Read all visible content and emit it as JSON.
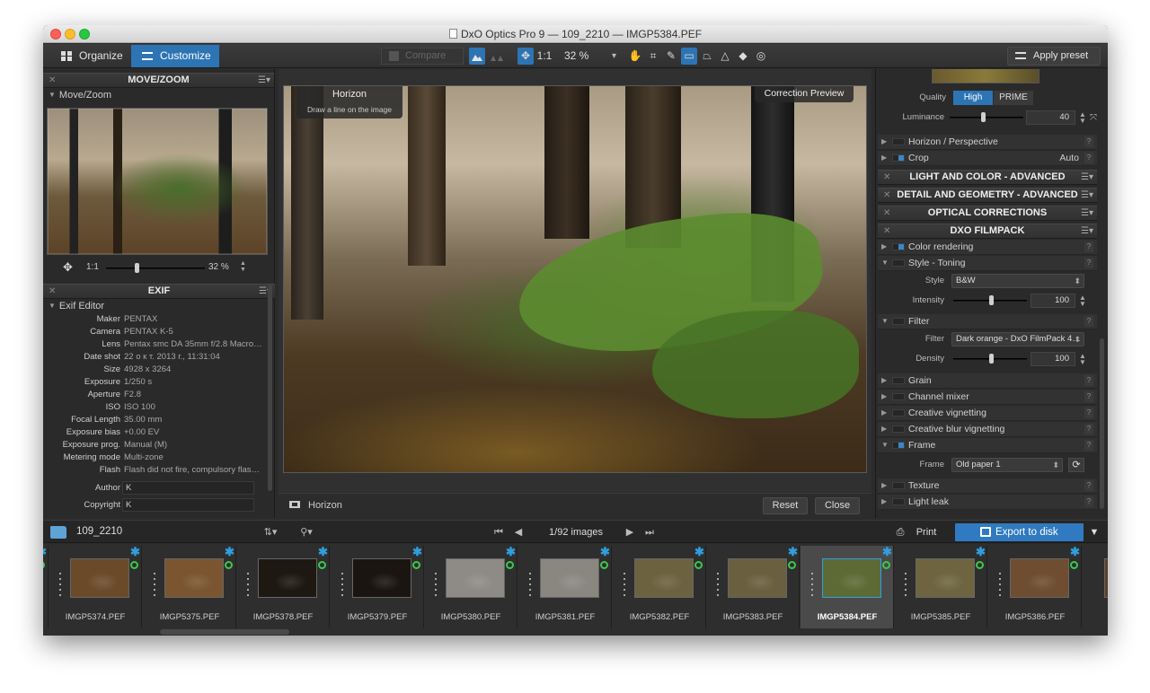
{
  "window": {
    "title": "DxO Optics Pro 9 — 109_2210 — IMGP5384.PEF"
  },
  "toolbar": {
    "tab_organize": "Organize",
    "tab_customize": "Customize",
    "compare_label": "Compare",
    "one_to_one": "1:1",
    "zoom_value": "32 %",
    "apply_preset": "Apply preset"
  },
  "left": {
    "movezoom_header": "MOVE/ZOOM",
    "movezoom_sub": "Move/Zoom",
    "nav_one_to_one": "1:1",
    "nav_zoom": "32 %",
    "nav_zoom_level": 0.32,
    "exif_header": "EXIF",
    "exif_sub": "Exif Editor",
    "exif_rows": [
      {
        "k": "Maker",
        "v": "PENTAX"
      },
      {
        "k": "Camera",
        "v": "PENTAX K-5"
      },
      {
        "k": "Lens",
        "v": "Pentax smc DA 35mm f/2.8 Macro…"
      },
      {
        "k": "Date shot",
        "v": "22 о к т. 2013 г., 11:31:04"
      },
      {
        "k": "Size",
        "v": "4928 x 3264"
      },
      {
        "k": "Exposure",
        "v": "1/250 s"
      },
      {
        "k": "Aperture",
        "v": "F2.8"
      },
      {
        "k": "ISO",
        "v": "ISO 100"
      },
      {
        "k": "Focal Length",
        "v": "35.00 mm"
      },
      {
        "k": "Exposure bias",
        "v": "+0.00 EV"
      },
      {
        "k": "Exposure prog.",
        "v": "Manual (M)"
      },
      {
        "k": "Metering mode",
        "v": "Multi-zone"
      },
      {
        "k": "Flash",
        "v": "Flash did not fire, compulsory flash…"
      }
    ],
    "author_label": "Author",
    "author_value": "K",
    "copyright_label": "Copyright",
    "copyright_value": "K"
  },
  "center": {
    "horizon_title": "Horizon",
    "horizon_hint": "Draw a line on the image",
    "correction_preview": "Correction Preview",
    "bottom_label": "Horizon",
    "reset": "Reset",
    "close": "Close"
  },
  "right": {
    "quality_label": "Quality",
    "quality_high": "High",
    "quality_prime": "PRIME",
    "luminance_label": "Luminance",
    "luminance_value": "40",
    "horizon_perspective": "Horizon / Perspective",
    "crop": "Crop",
    "crop_value": "Auto",
    "hdr_light": "LIGHT AND COLOR - ADVANCED",
    "hdr_detail": "DETAIL AND GEOMETRY - ADVANCED",
    "hdr_optical": "OPTICAL CORRECTIONS",
    "hdr_filmpack": "DXO FILMPACK",
    "color_rendering": "Color rendering",
    "style_toning": "Style - Toning",
    "style_label": "Style",
    "style_value": "B&W",
    "intensity_label": "Intensity",
    "intensity_value": "100",
    "filter": "Filter",
    "filter_label": "Filter",
    "filter_value": "Dark orange - DxO FilmPack 4…",
    "density_label": "Density",
    "density_value": "100",
    "grain": "Grain",
    "channel_mixer": "Channel mixer",
    "creative_vignetting": "Creative vignetting",
    "creative_blur": "Creative blur vignetting",
    "frame": "Frame",
    "frame_label": "Frame",
    "frame_value": "Old paper 1",
    "texture": "Texture",
    "light_leak": "Light leak"
  },
  "filmstrip": {
    "folder": "109_2210",
    "counter": "1/92 images",
    "print": "Print",
    "export": "Export to disk",
    "items": [
      {
        "name": "IMGP5374.PEF",
        "bg": "#6b4a2a"
      },
      {
        "name": "IMGP5375.PEF",
        "bg": "#7a5530"
      },
      {
        "name": "IMGP5378.PEF",
        "bg": "#1e1812"
      },
      {
        "name": "IMGP5379.PEF",
        "bg": "#1a1510"
      },
      {
        "name": "IMGP5380.PEF",
        "bg": "#8e8a85"
      },
      {
        "name": "IMGP5381.PEF",
        "bg": "#8a8680"
      },
      {
        "name": "IMGP5382.PEF",
        "bg": "#6d6240"
      },
      {
        "name": "IMGP5383.PEF",
        "bg": "#6a5f3e"
      },
      {
        "name": "IMGP5384.PEF",
        "bg": "#5d6a36"
      },
      {
        "name": "IMGP5385.PEF",
        "bg": "#6e6540"
      },
      {
        "name": "IMGP5386.PEF",
        "bg": "#6e4d30"
      }
    ]
  }
}
